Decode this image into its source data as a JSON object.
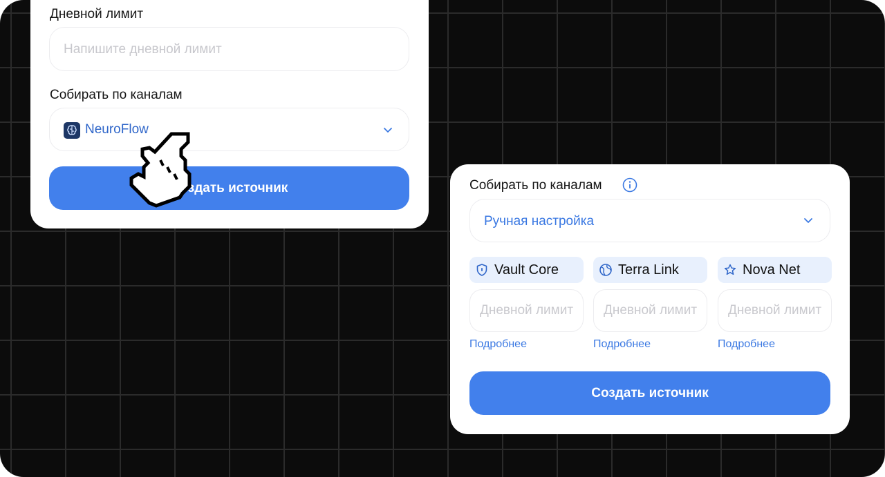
{
  "colors": {
    "accent": "#4280ec",
    "background": "#0c0c0c",
    "card": "#ffffff",
    "chip": "#e8f0fd"
  },
  "left_card": {
    "daily_limit_label": "Дневной лимит",
    "daily_limit_placeholder": "Напишите дневной лимит",
    "channels_label": "Собирать по каналам",
    "selected_channel": {
      "icon": "brain-icon",
      "label": "NeuroFlow"
    },
    "create_button": "Создать источник"
  },
  "right_card": {
    "channels_label": "Собирать по каналам",
    "select_value": "Ручная настройка",
    "channels": [
      {
        "name": "Vault Core",
        "icon": "shield-icon",
        "placeholder": "Дневной лимит",
        "link": "Подробнее"
      },
      {
        "name": "Terra Link",
        "icon": "globe-icon",
        "placeholder": "Дневной лимит",
        "link": "Подробнее"
      },
      {
        "name": "Nova Net",
        "icon": "star-icon",
        "placeholder": "Дневной лимит",
        "link": "Подробнее"
      }
    ],
    "create_button": "Создать источник"
  }
}
